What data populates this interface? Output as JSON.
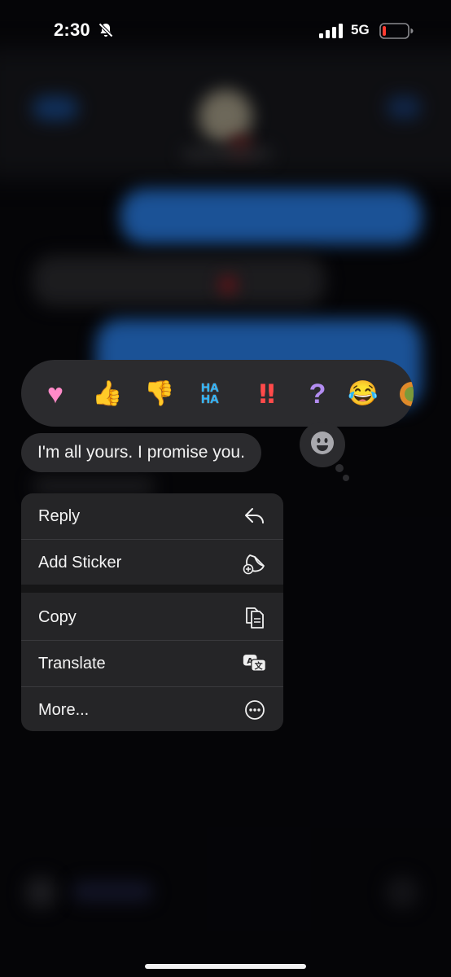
{
  "status_bar": {
    "time": "2:30",
    "network": "5G"
  },
  "reactions": [
    {
      "name": "heart",
      "glyph": "♥"
    },
    {
      "name": "thumbs-up",
      "glyph": "👍"
    },
    {
      "name": "thumbs-down",
      "glyph": "👎"
    },
    {
      "name": "haha",
      "line1": "HA",
      "line2": "HA"
    },
    {
      "name": "exclamation",
      "glyph": "‼"
    },
    {
      "name": "question",
      "glyph": "?"
    },
    {
      "name": "laughing",
      "glyph": "😂"
    }
  ],
  "message": {
    "text": "I'm all yours. I promise you."
  },
  "menu": {
    "items": [
      {
        "label": "Reply",
        "icon": "reply-icon"
      },
      {
        "label": "Add Sticker",
        "icon": "add-sticker-icon"
      },
      {
        "label": "Copy",
        "icon": "copy-icon"
      },
      {
        "label": "Translate",
        "icon": "translate-icon"
      },
      {
        "label": "More...",
        "icon": "more-icon"
      }
    ]
  },
  "colors": {
    "bubble": "#2b2b2e",
    "menu": "#252527",
    "accent_blue": "#2a7ee6"
  }
}
